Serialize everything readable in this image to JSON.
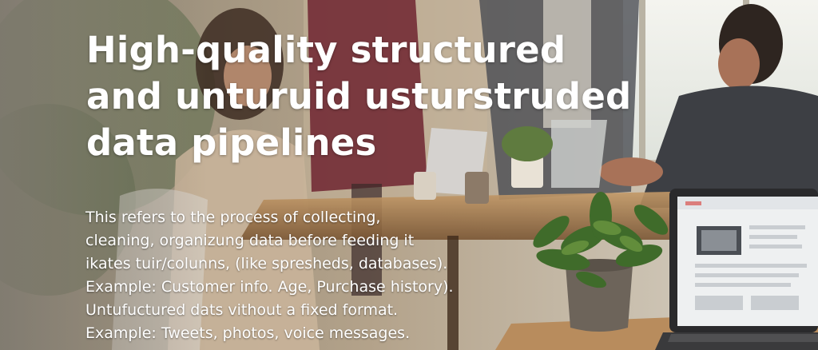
{
  "headline": {
    "lines": [
      "High-quality structured",
      "and unturuid usturstruded",
      "data pipelines"
    ]
  },
  "body": {
    "lines": [
      "This refers to the process of collecting,",
      "cleaning, organizung data before feeding it",
      "ikates tuir/colunns, (like spresheds, databases).",
      "Example: Customer info. Age, Purchase history).",
      "Untufuctured dats vithout a fixed format.",
      "Example: Tweets, photos, voice messages."
    ]
  }
}
